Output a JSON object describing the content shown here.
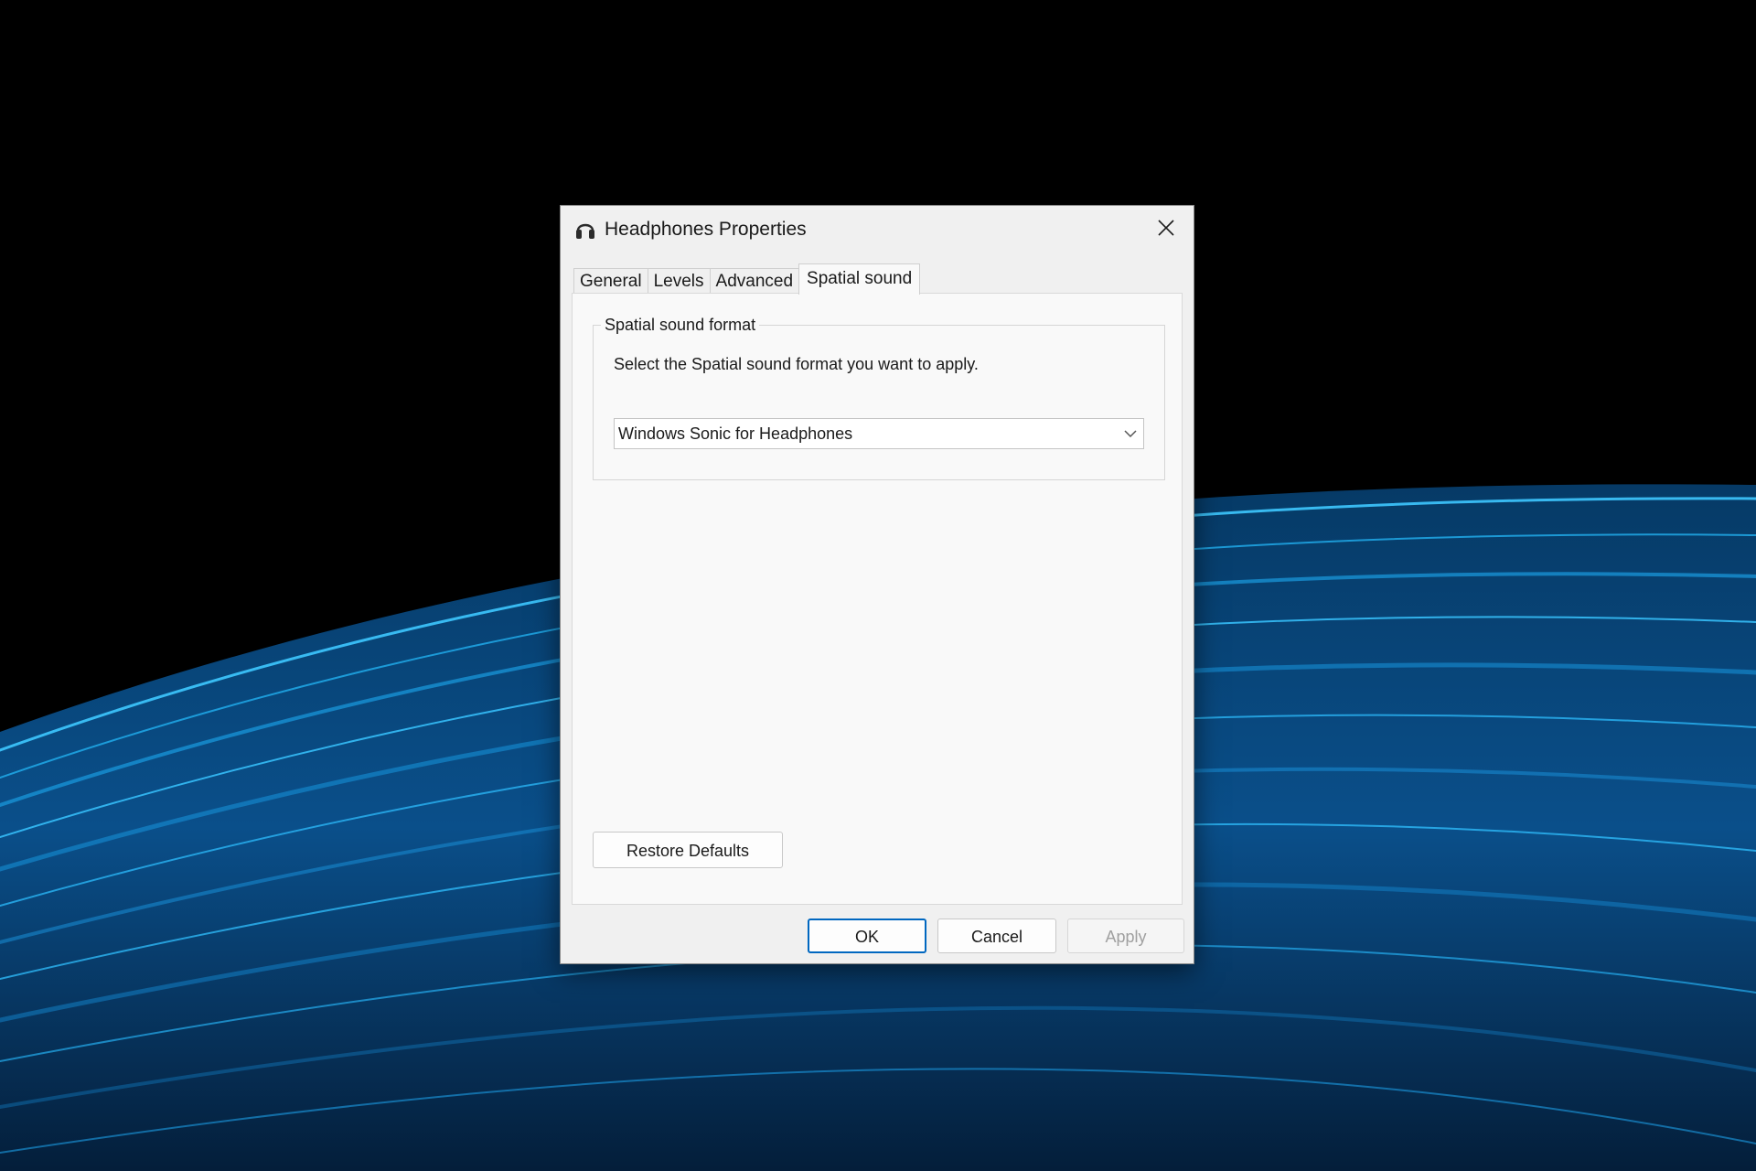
{
  "window": {
    "title": "Headphones Properties",
    "icon": "headphones-icon"
  },
  "tabs": [
    {
      "label": "General",
      "active": false
    },
    {
      "label": "Levels",
      "active": false
    },
    {
      "label": "Advanced",
      "active": false
    },
    {
      "label": "Spatial sound",
      "active": true
    }
  ],
  "spatial": {
    "group_label": "Spatial sound format",
    "description": "Select the Spatial sound format you want to apply.",
    "format_selected": "Windows Sonic for Headphones"
  },
  "buttons": {
    "restore_defaults": "Restore Defaults",
    "ok": "OK",
    "cancel": "Cancel",
    "apply": "Apply"
  },
  "colors": {
    "accent": "#0067c0",
    "wallpaper_background": "#000000",
    "wallpaper_streaks": "#1aa3e8"
  }
}
